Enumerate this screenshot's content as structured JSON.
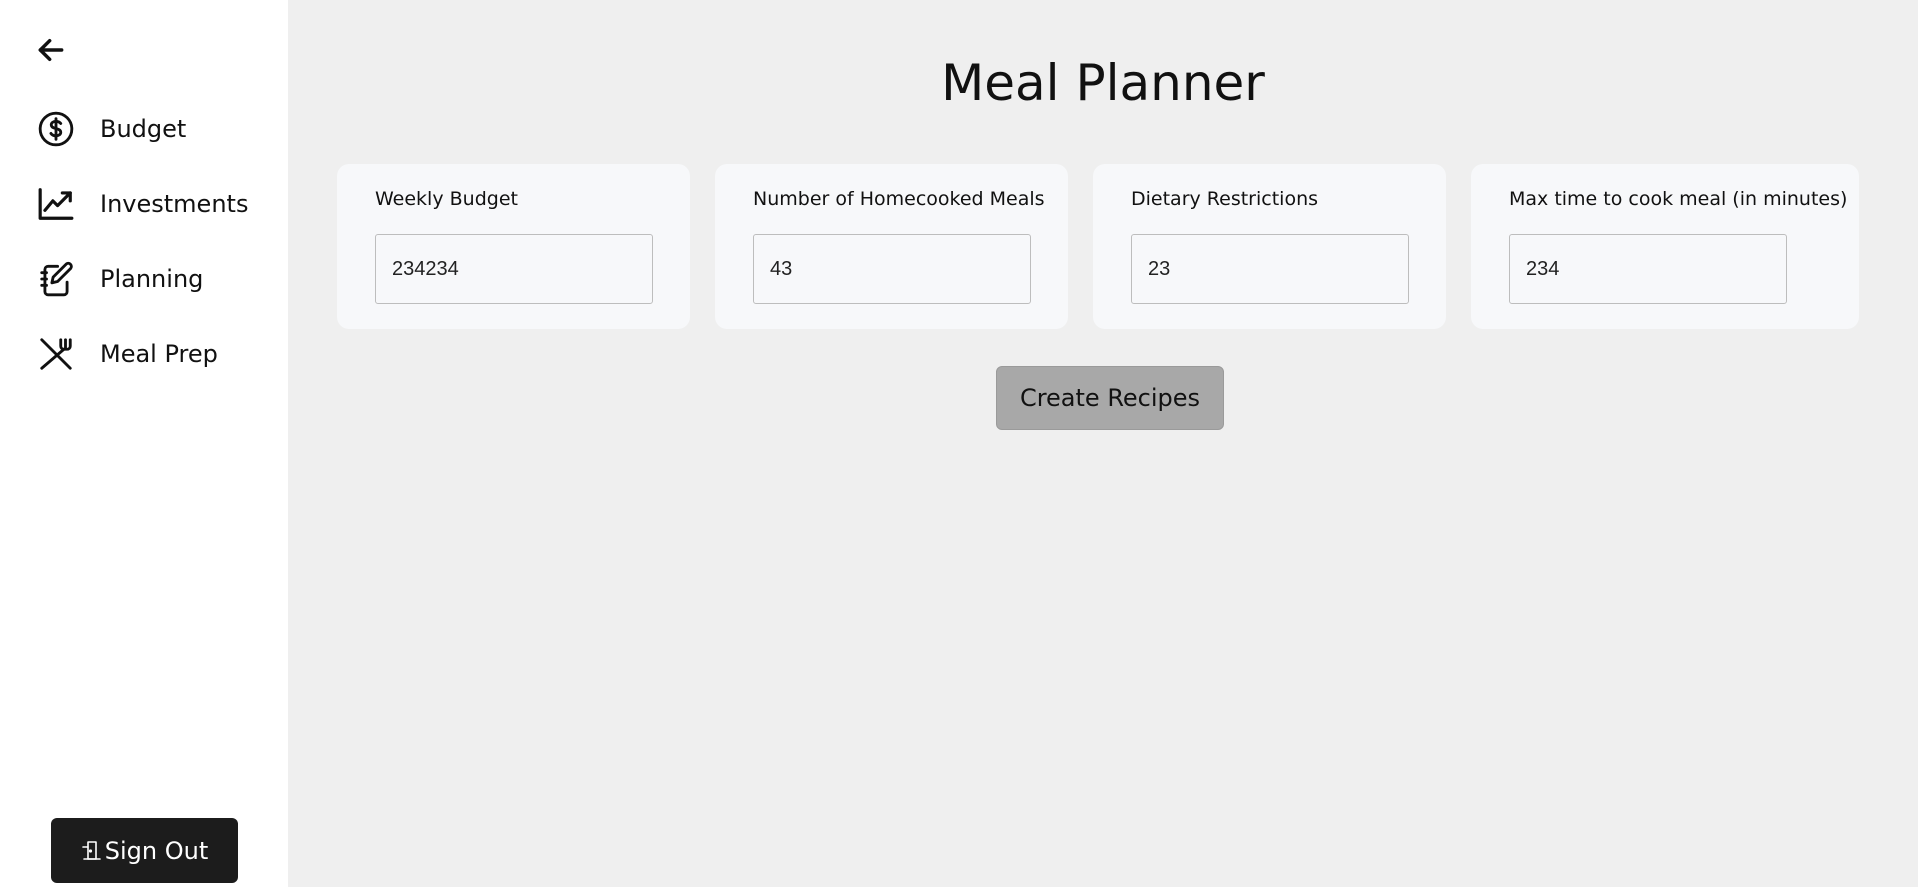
{
  "sidebar": {
    "back_icon": "arrow-left-icon",
    "items": [
      {
        "label": "Budget",
        "icon": "dollar-circle-icon"
      },
      {
        "label": "Investments",
        "icon": "chart-line-icon"
      },
      {
        "label": "Planning",
        "icon": "notebook-pen-icon"
      },
      {
        "label": "Meal Prep",
        "icon": "utensils-crossed-icon"
      }
    ],
    "signout_label": "Sign Out",
    "signout_icon": "door-exit-icon"
  },
  "main": {
    "title": "Meal Planner",
    "fields": [
      {
        "label": "Weekly Budget",
        "value": "234234"
      },
      {
        "label": "Number of Homecooked Meals",
        "value": "43"
      },
      {
        "label": "Dietary Restrictions",
        "value": "23"
      },
      {
        "label": "Max time to cook meal (in minutes)",
        "value": "234"
      }
    ],
    "create_button_label": "Create Recipes"
  },
  "colors": {
    "sidebar_bg": "#ffffff",
    "main_bg": "#efefef",
    "card_bg": "#f7f8fa",
    "signout_bg": "#1c1c1c",
    "create_button_bg": "#a8a8a8"
  }
}
